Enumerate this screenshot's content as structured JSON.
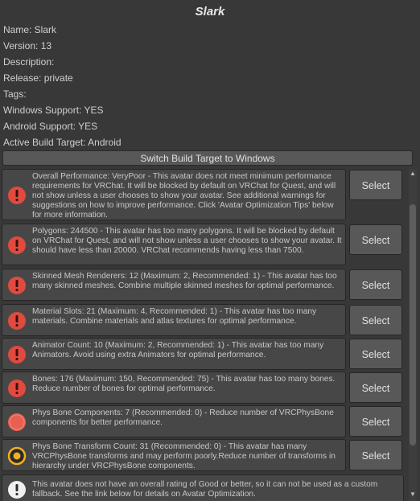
{
  "title": "Slark",
  "info": {
    "name": "Name: Slark",
    "version": "Version: 13",
    "description": "Description:",
    "release": "Release: private",
    "tags": "Tags:",
    "windows_support": "Windows Support: YES",
    "android_support": "Android Support: YES",
    "active_build_target": "Active Build Target: Android"
  },
  "switch_button_label": "Switch Build Target to Windows",
  "messages": [
    {
      "severity": "error",
      "text": "Overall Performance: VeryPoor - This avatar does not meet minimum performance requirements for VRChat. It will be blocked by default on VRChat for Quest, and will not show unless a user chooses to show your avatar. See additional warnings for suggestions on how to improve performance. Click 'Avatar Optimization Tips' below for more information.",
      "button": "Select"
    },
    {
      "severity": "error",
      "text": "Polygons: 244500 - This avatar has too many polygons. It will be blocked by default on VRChat for Quest, and will not show unless a user chooses to show your avatar. It should have less than 20000. VRChat recommends having less than 7500.",
      "button": "Select"
    },
    {
      "severity": "error",
      "text": "Skinned Mesh Renderers: 12 (Maximum: 2, Recommended: 1) - This avatar has too many skinned meshes. Combine multiple skinned meshes for optimal performance.",
      "button": "Select"
    },
    {
      "severity": "error",
      "text": "Material Slots: 21 (Maximum: 4, Recommended: 1) - This avatar has too many materials. Combine materials and atlas textures for optimal performance.",
      "button": "Select"
    },
    {
      "severity": "error",
      "text": "Animator Count: 10 (Maximum: 2, Recommended: 1) - This avatar has too many Animators. Avoid using extra Animators for optimal performance.",
      "button": "Select"
    },
    {
      "severity": "error",
      "text": "Bones: 176 (Maximum: 150, Recommended: 75) - This avatar has too many bones. Reduce number of bones for optimal performance.",
      "button": "Select"
    },
    {
      "severity": "poor",
      "text": "Phys Bone Components: 7 (Recommended: 0) - Reduce number of VRCPhysBone components for better performance.",
      "button": "Select"
    },
    {
      "severity": "medium",
      "text": "Phys Bone Transform Count: 31 (Recommended: 0) - This avatar has many VRCPhysBone transforms and may perform poorly.Reduce number of transforms in hierarchy under VRCPhysBone components.",
      "button": "Select"
    },
    {
      "severity": "info",
      "text": "This avatar does not have an overall rating of Good or better, so it can not be used as a custom fallback. See the link below for details on Avatar Optimization.",
      "button": ""
    }
  ],
  "colors": {
    "background": "#383838",
    "error_icon": "#e04a3f",
    "poor_icon": "#e86050",
    "medium_icon": "#f0b020",
    "info_icon": "#f0f0f0"
  }
}
